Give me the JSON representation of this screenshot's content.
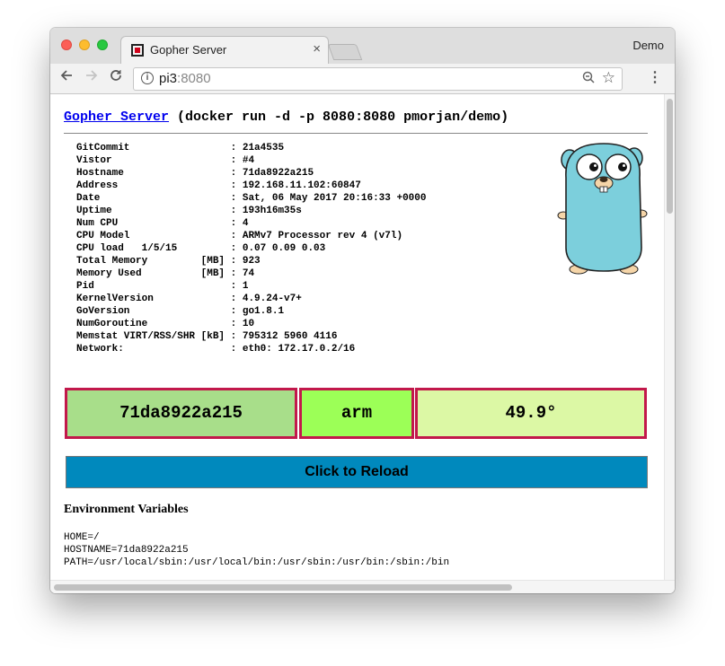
{
  "browser": {
    "tab_title": "Gopher Server",
    "tab_close": "×",
    "profile": "Demo",
    "url_host": "pi3",
    "url_port": ":8080",
    "icons": {
      "back": "arrow-left-icon",
      "forward": "arrow-right-icon",
      "reload": "reload-icon",
      "info": "info-icon",
      "zoom": "zoom-out-icon",
      "bookmark": "star-icon",
      "menu": "kebab-menu-icon"
    }
  },
  "page": {
    "title_link": "Gopher Server",
    "title_rest": " (docker run -d -p 8080:8080 pmorjan/demo)",
    "info_rows": [
      {
        "key": "GitCommit                 ",
        "value": ": 21a4535"
      },
      {
        "key": "Vistor                    ",
        "value": ": #4"
      },
      {
        "key": "Hostname                  ",
        "value": ": 71da8922a215"
      },
      {
        "key": "Address                   ",
        "value": ": 192.168.11.102:60847"
      },
      {
        "key": "Date                      ",
        "value": ": Sat, 06 May 2017 20:16:33 +0000"
      },
      {
        "key": "Uptime                    ",
        "value": ": 193h16m35s"
      },
      {
        "key": "Num CPU                   ",
        "value": ": 4"
      },
      {
        "key": "CPU Model                 ",
        "value": ": ARMv7 Processor rev 4 (v7l)"
      },
      {
        "key": "CPU load   1/5/15         ",
        "value": ": 0.07 0.09 0.03"
      },
      {
        "key": "Total Memory         [MB] ",
        "value": ": 923"
      },
      {
        "key": "Memory Used          [MB] ",
        "value": ": 74"
      },
      {
        "key": "Pid                       ",
        "value": ": 1"
      },
      {
        "key": "KernelVersion             ",
        "value": ": 4.9.24-v7+"
      },
      {
        "key": "GoVersion                 ",
        "value": ": go1.8.1"
      },
      {
        "key": "NumGoroutine              ",
        "value": ": 10"
      },
      {
        "key": "Memstat VIRT/RSS/SHR [kB] ",
        "value": ": 795312 5960 4116"
      },
      {
        "key": "Network:                  ",
        "value": ": eth0: 172.17.0.2/16"
      }
    ],
    "boxes": {
      "hostname": "71da8922a215",
      "arch": "arm",
      "temperature": "49.9°"
    },
    "box_colors": {
      "hostname": "#a8de8a",
      "arch": "#9cff57",
      "temperature": "#dcf8a5",
      "border": "#c2184b"
    },
    "reload_label": "Click to Reload",
    "reload_color": "#0089bd",
    "env_title": "Environment Variables",
    "env_rows": [
      "HOME=/",
      "HOSTNAME=71da8922a215",
      "PATH=/usr/local/sbin:/usr/local/bin:/usr/sbin:/usr/bin:/sbin:/bin"
    ],
    "mascot": "gopher-mascot-icon"
  }
}
